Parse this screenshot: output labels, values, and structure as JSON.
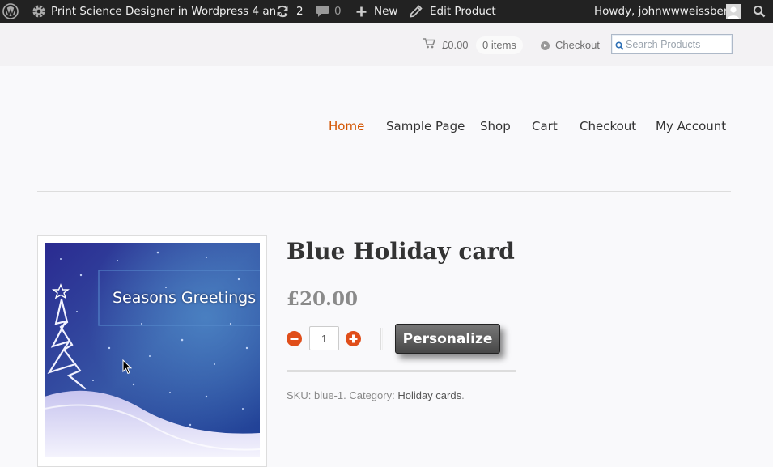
{
  "admin_bar": {
    "site_title": "Print Science Designer in Wordpress 4 an…",
    "updates_count": "2",
    "comments_count": "0",
    "new_label": "New",
    "edit_label": "Edit Product",
    "howdy": "Howdy, johnwwweissberg",
    "icons": [
      "wordpress-logo-icon",
      "updates-icon",
      "comments-icon",
      "plus-icon",
      "pencil-icon",
      "user-avatar-icon",
      "search-icon"
    ]
  },
  "header": {
    "cart_total": "£0.00",
    "cart_items": "0 items",
    "checkout_label": "Checkout",
    "search_placeholder": "Search Products"
  },
  "nav": {
    "items": [
      {
        "label": "Home",
        "active": true
      },
      {
        "label": "Sample Page",
        "active": false
      },
      {
        "label": "Shop",
        "active": false
      },
      {
        "label": "Cart",
        "active": false
      },
      {
        "label": "Checkout",
        "active": false
      },
      {
        "label": "My Account",
        "active": false
      }
    ],
    "active_color": "#d35400"
  },
  "product": {
    "title": "Blue Holiday card",
    "price": "£20.00",
    "quantity": "1",
    "personalize_label": "Personalize",
    "image_text": "Seasons Greetings",
    "sku_label": "SKU:",
    "sku": "blue-1",
    "category_label": "Category:",
    "category": "Holiday cards"
  }
}
